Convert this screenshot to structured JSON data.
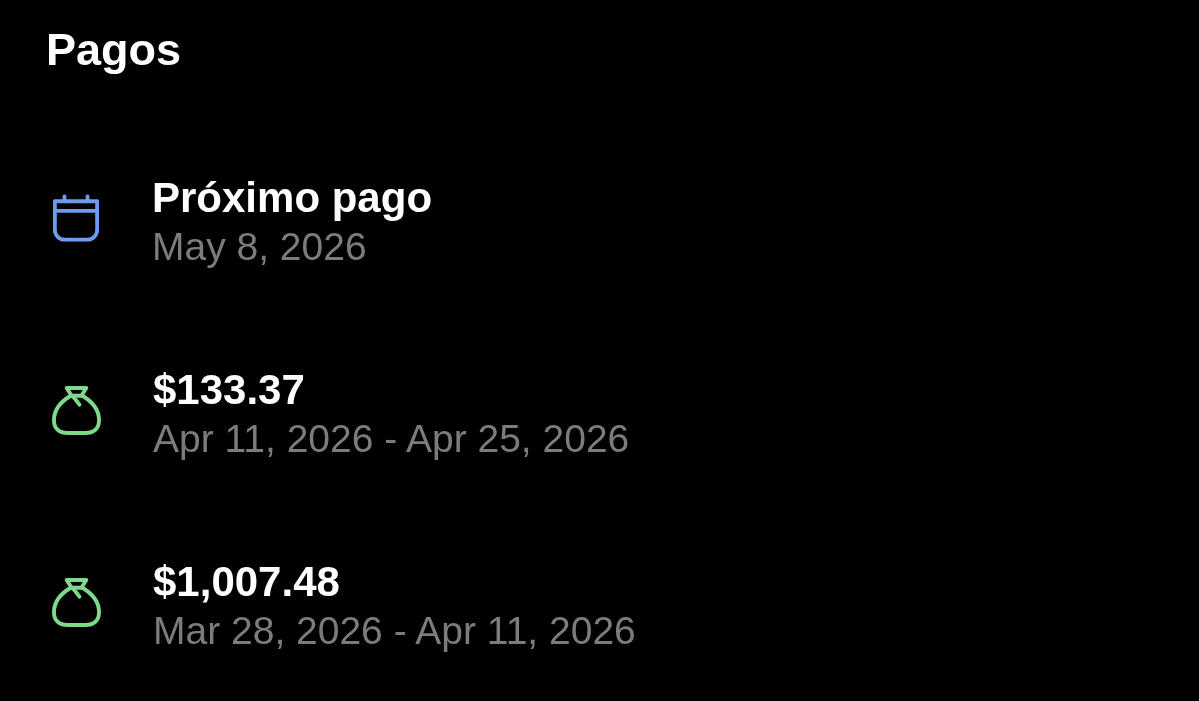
{
  "header": {
    "title": "Pagos"
  },
  "payments": [
    {
      "kind": "calendar",
      "color": "#6c9cf0",
      "title": "Próximo pago",
      "subtitle": "May 8, 2026"
    },
    {
      "kind": "money-bag",
      "color": "#7dd98b",
      "title": "$133.37",
      "subtitle": "Apr 11, 2026 - Apr 25, 2026"
    },
    {
      "kind": "money-bag",
      "color": "#7dd98b",
      "title": "$1,007.48",
      "subtitle": "Mar 28, 2026 - Apr 11, 2026"
    }
  ]
}
